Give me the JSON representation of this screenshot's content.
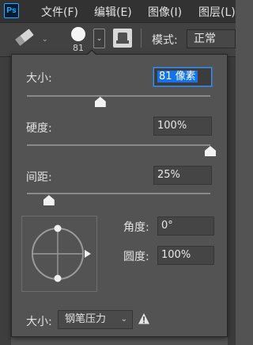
{
  "app": {
    "logo": "Ps"
  },
  "menu": {
    "items": [
      "文件(F)",
      "编辑(E)",
      "图像(I)",
      "图层(L)"
    ]
  },
  "options_bar": {
    "brush_size": "81",
    "mode_label": "模式:",
    "mode_value": "正常"
  },
  "popup": {
    "size_label": "大小:",
    "size_value": "81 像素",
    "size_fraction": 0.4,
    "hardness_label": "硬度:",
    "hardness_value": "100%",
    "hardness_fraction": 1.0,
    "spacing_label": "间距:",
    "spacing_value": "25%",
    "spacing_fraction": 0.12,
    "angle_label": "角度:",
    "angle_value": "0°",
    "roundness_label": "圆度:",
    "roundness_value": "100%",
    "footer_label": "大小:",
    "footer_select": "钢笔压力"
  },
  "colors": {
    "accent": "#1473e6",
    "panel": "#535353",
    "menubar": "#323232"
  },
  "icons": [
    "ps-logo",
    "eraser-icon",
    "chevron-down-icon",
    "brush-preset-icon",
    "stamp-icon",
    "warning-icon"
  ]
}
